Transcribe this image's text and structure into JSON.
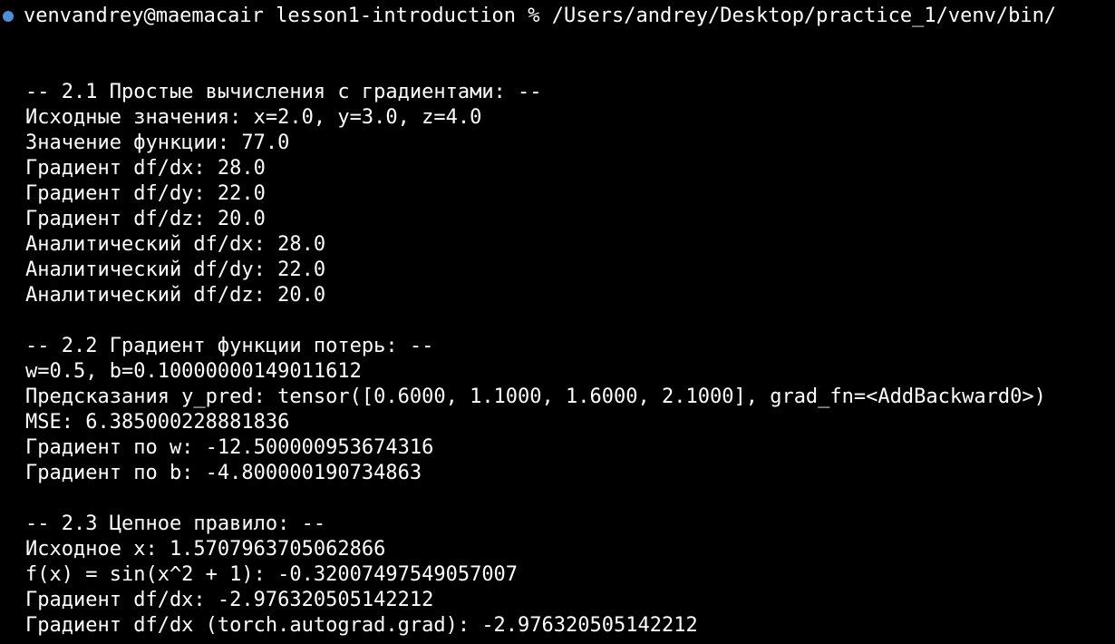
{
  "prompt": {
    "text": "venvandrey@maemacair lesson1-introduction % /Users/andrey/Desktop/practice_1/venv/bin/"
  },
  "sections": [
    {
      "header": "-- 2.1 Простые вычисления с градиентами: --",
      "lines": [
        "Исходные значения: x=2.0, y=3.0, z=4.0",
        "Значение функции: 77.0",
        "Градиент df/dx: 28.0",
        "Градиент df/dy: 22.0",
        "Градиент df/dz: 20.0",
        "Аналитический df/dx: 28.0",
        "Аналитический df/dy: 22.0",
        "Аналитический df/dz: 20.0"
      ]
    },
    {
      "header": "-- 2.2 Градиент функции потерь: --",
      "lines": [
        "w=0.5, b=0.10000000149011612",
        "Предсказания y_pred: tensor([0.6000, 1.1000, 1.6000, 2.1000], grad_fn=<AddBackward0>)",
        "MSE: 6.385000228881836",
        "Градиент по w: -12.500000953674316",
        "Градиент по b: -4.800000190734863"
      ]
    },
    {
      "header": "-- 2.3 Цепное правило: --",
      "lines": [
        "Исходное x: 1.5707963705062866",
        "f(x) = sin(x^2 + 1): -0.32007497549057007",
        "Градиент df/dx: -2.976320505142212",
        "Градиент df/dx (torch.autograd.grad): -2.976320505142212"
      ]
    }
  ],
  "colors": {
    "background": "#000000",
    "text": "#ffffff",
    "status_dot": "#4a90d9"
  }
}
